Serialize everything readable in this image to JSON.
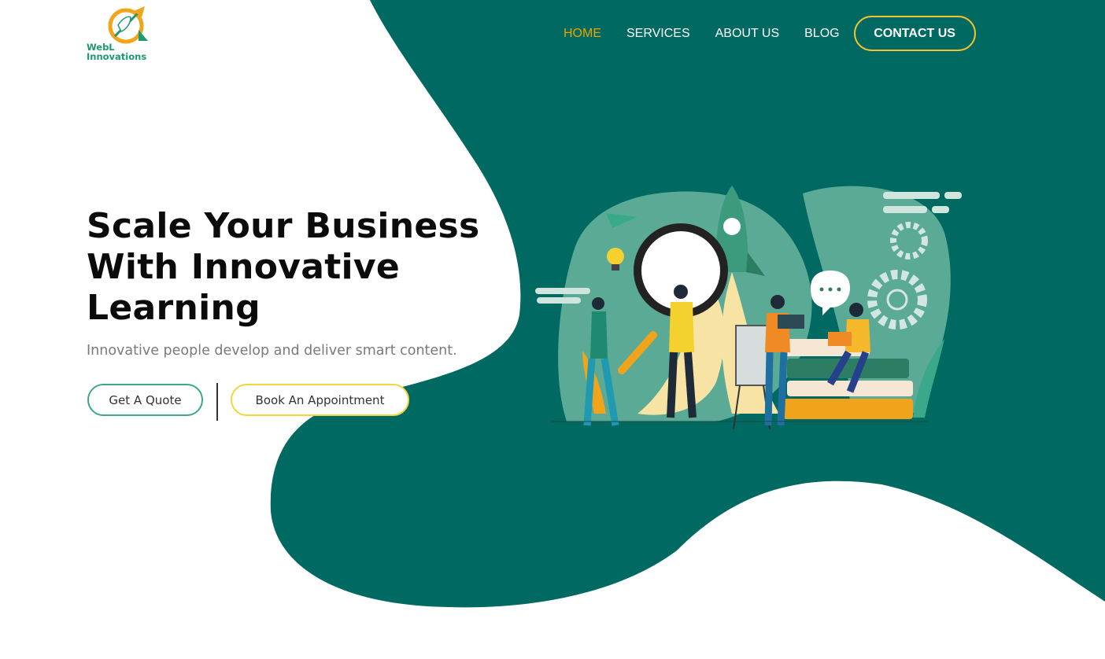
{
  "brand": {
    "logo_text": "WebL\nInnovations",
    "logo_icon": "rocket-target-icon"
  },
  "nav": {
    "items": [
      {
        "label": "HOME",
        "active": true
      },
      {
        "label": "SERVICES",
        "active": false
      },
      {
        "label": "ABOUT US",
        "active": false
      },
      {
        "label": "BLOG",
        "active": false
      }
    ],
    "contact_label": "CONTACT US"
  },
  "hero": {
    "title": "Scale Your Business With Innovative Learning",
    "subtitle": "Innovative people develop and deliver smart content.",
    "quote_button": "Get A Quote",
    "appointment_button": "Book An Appointment"
  },
  "illustration": {
    "name": "team-launching-rocket-illustration"
  },
  "colors": {
    "primary_teal": "#006a62",
    "accent_yellow": "#f2c230",
    "active_nav": "#e8a300",
    "logo_green": "#1c9a6e"
  }
}
